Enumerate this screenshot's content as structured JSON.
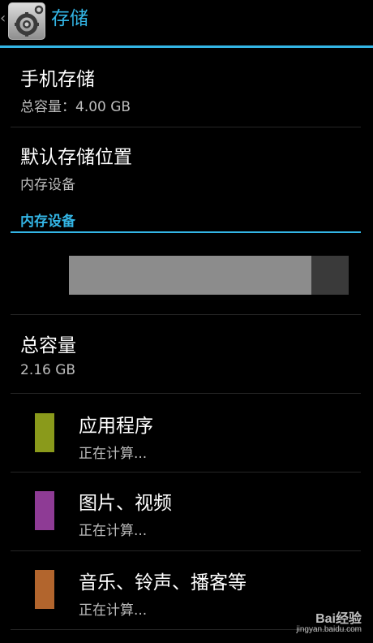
{
  "header": {
    "title": "存储",
    "icon": "settings-gear-icon",
    "accent_color": "#33b5e5"
  },
  "prefs": {
    "phone_storage": {
      "title": "手机存储",
      "summary": "总容量：4.00 GB"
    },
    "default_location": {
      "title": "默认存储位置",
      "summary": "内存设备"
    }
  },
  "internal": {
    "category_title": "内存设备",
    "usage_fraction": 0.866,
    "total": {
      "title": "总容量",
      "value": "2.16 GB"
    },
    "items": [
      {
        "label": "应用程序",
        "status": "正在计算...",
        "color": "#8a9a1b"
      },
      {
        "label": "图片、视频",
        "status": "正在计算...",
        "color": "#8e3b95"
      },
      {
        "label": "音乐、铃声、播客等",
        "status": "正在计算...",
        "color": "#b2652d"
      }
    ]
  },
  "watermark": {
    "brand": "Bai经验",
    "url": "jingyan.baidu.com"
  }
}
